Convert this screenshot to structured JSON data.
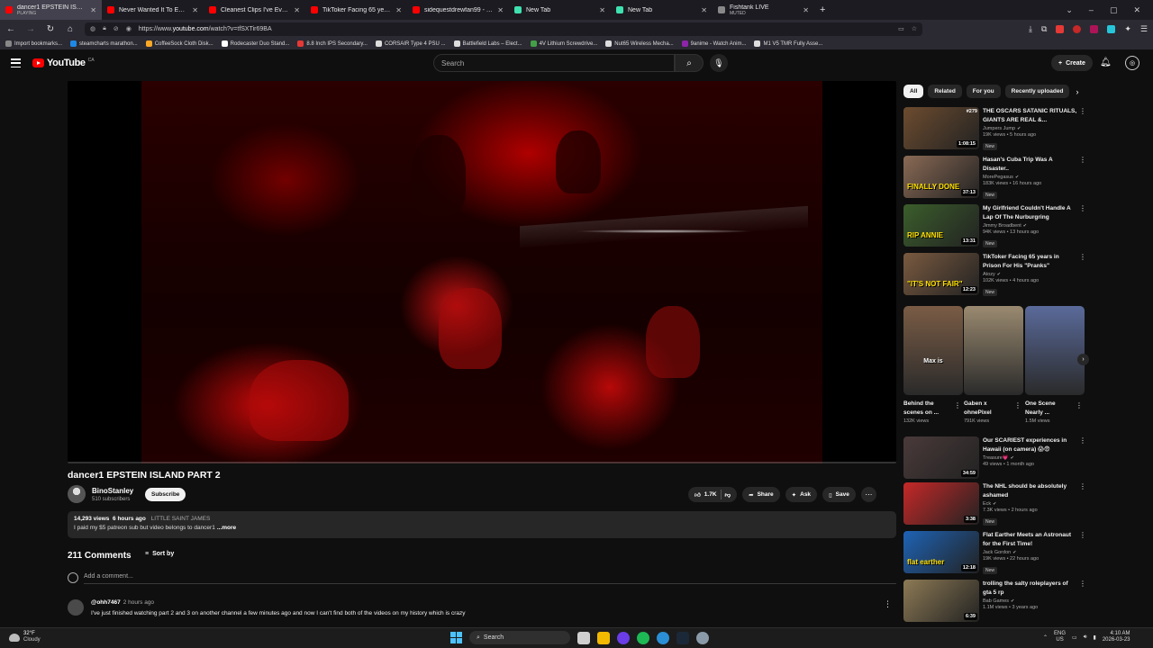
{
  "browser": {
    "tabs": [
      {
        "title": "dancer1 EPSTEIN ISLAND PART",
        "sub": "PLAYING",
        "active": true,
        "color": "#ff0000"
      },
      {
        "title": "Never Wanted It To End - YouTu",
        "sub": "",
        "active": false,
        "color": "#ff0000"
      },
      {
        "title": "Cleanest Clips I've Ever Hit... (Ji",
        "sub": "",
        "active": false,
        "color": "#ff0000"
      },
      {
        "title": "TikToker Facing 65 years in Priso",
        "sub": "",
        "active": false,
        "color": "#ff0000"
      },
      {
        "title": "sidequestdrewfan99 - YouTube",
        "sub": "",
        "active": false,
        "color": "#ff0000"
      },
      {
        "title": "New Tab",
        "sub": "",
        "active": false,
        "color": "#3fe1b0"
      },
      {
        "title": "New Tab",
        "sub": "",
        "active": false,
        "color": "#3fe1b0"
      },
      {
        "title": "Fishtank LIVE",
        "sub": "MUTED",
        "active": false,
        "color": "#888888"
      }
    ],
    "url_prefix": "https://www.",
    "url_domain": "youtube.com",
    "url_path": "/watch?v=tfSXTir69BA",
    "bookmarks": [
      {
        "label": "Import bookmarks...",
        "color": "#888888"
      },
      {
        "label": "steamcharts marathon...",
        "color": "#1e88e5"
      },
      {
        "label": "CoffeeSock Cloth Disk...",
        "color": "#f9a825"
      },
      {
        "label": "Rodecaster Duo Stand...",
        "color": "#ffffff"
      },
      {
        "label": "8.8 Inch IPS Secondary...",
        "color": "#e53935"
      },
      {
        "label": "CORSAIR Type 4 PSU ...",
        "color": "#dddddd"
      },
      {
        "label": "Battlefield Labs – Elect...",
        "color": "#dddddd"
      },
      {
        "label": "4V Lithium Screwdrive...",
        "color": "#43a047"
      },
      {
        "label": "Nut65 Wireless Mecha...",
        "color": "#dddddd"
      },
      {
        "label": "9anime - Watch Anim...",
        "color": "#8e24aa"
      },
      {
        "label": "M1 V5 TMR Fully Asse...",
        "color": "#dddddd"
      }
    ]
  },
  "header": {
    "logo_text": "YouTube",
    "country": "CA",
    "search_placeholder": "Search",
    "create_label": "Create"
  },
  "video": {
    "title": "dancer1 EPSTEIN ISLAND PART 2",
    "channel": "BinoStanley",
    "subscribers": "510 subscribers",
    "subscribe_label": "Subscribe",
    "likes": "1.7K",
    "share_label": "Share",
    "ask_label": "Ask",
    "save_label": "Save",
    "views": "14,293 views",
    "age": "6 hours ago",
    "tag": "LITTLE SAINT JAMES",
    "description": "I paid my $5 patreon sub but video belongs to dancer1",
    "more_label": "...more"
  },
  "comments": {
    "count": "211 Comments",
    "sort_label": "Sort by",
    "add_placeholder": "Add a comment...",
    "items": [
      {
        "author": "@ohh7467",
        "time": "2 hours ago",
        "text": "I've just finished watching part 2 and 3 on another channel a few minutes ago and now I can't find both of the videos on my history which is crazy"
      }
    ]
  },
  "sidebar": {
    "chips": [
      "All",
      "Related",
      "For you",
      "Recently uploaded"
    ],
    "recommendations": [
      {
        "title": "THE OSCARS SATANIC RITUALS, GIANTS ARE REAL &...",
        "channel": "Jumpers Jump",
        "meta": "19K views • 5 hours ago",
        "new": "New",
        "duration": "1:08:15",
        "badge": "#279",
        "caption": "",
        "bg": "#6d4c2f"
      },
      {
        "title": "Hasan's Cuba Trip Was A Disaster..",
        "channel": "MorePegasus",
        "meta": "183K views • 16 hours ago",
        "new": "New",
        "duration": "37:13",
        "badge": "",
        "caption": "FINALLY DONE",
        "bg": "#8a6a55"
      },
      {
        "title": "My Girlfriend Couldn't Handle A Lap Of The Nurburgring",
        "channel": "Jimmy Broadbent",
        "meta": "94K views • 13 hours ago",
        "new": "New",
        "duration": "13:31",
        "badge": "",
        "caption": "RIP ANNIE",
        "bg": "#3b5e2b"
      },
      {
        "title": "TikToker Facing 65 years in Prison For His \"Pranks\"",
        "channel": "Atozy",
        "meta": "102K views • 4 hours ago",
        "new": "New",
        "duration": "12:23",
        "badge": "",
        "caption": "\"IT'S NOT FAIR\"",
        "bg": "#7a5a40"
      },
      {
        "title": "Our SCARIEST experiences in Hawaii (on camera) 😱😨",
        "channel": "Treasure💗",
        "meta": "49 views • 1 month ago",
        "new": "",
        "duration": "34:59",
        "badge": "",
        "caption": "",
        "bg": "#4a3a3a"
      },
      {
        "title": "The NHL should be absolutely ashamed",
        "channel": "Eck",
        "meta": "7.3K views • 2 hours ago",
        "new": "New",
        "duration": "3:38",
        "badge": "",
        "caption": "",
        "bg": "#c62828"
      },
      {
        "title": "Flat Earther Meets an Astronaut for the First Time!",
        "channel": "Jack Gordon",
        "meta": "19K views • 22 hours ago",
        "new": "New",
        "duration": "12:18",
        "badge": "",
        "caption": "flat earther",
        "bg": "#1e63b5"
      },
      {
        "title": "trolling the salty roleplayers of gta 5 rp",
        "channel": "Bab Games",
        "meta": "1.1M views • 3 years ago",
        "new": "",
        "duration": "6:39",
        "badge": "",
        "caption": "",
        "bg": "#8d7a55"
      }
    ],
    "shorts": [
      {
        "title": "Behind the scenes on ...",
        "views": "132K views",
        "caption": "Max is",
        "bg": "#7a5c45"
      },
      {
        "title": "Gaben x ohnePixel",
        "views": "791K views",
        "caption": "",
        "bg": "#9a8a70"
      },
      {
        "title": "One Scene Nearly ...",
        "views": "1.5M views",
        "caption": "",
        "bg": "#5a6a9a"
      }
    ]
  },
  "taskbar": {
    "temp": "32°F",
    "condition": "Cloudy",
    "search_label": "Search",
    "lang_top": "ENG",
    "lang_bottom": "US",
    "time": "4:10 AM",
    "date": "2026-03-23"
  }
}
